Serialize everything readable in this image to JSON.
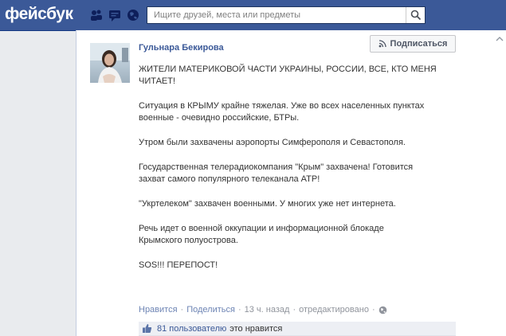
{
  "header": {
    "logo": "фейсбук",
    "search": {
      "placeholder": "Ищите друзей, места или предметы"
    }
  },
  "post": {
    "author": "Гульнара Бекирова",
    "subscribe_label": "Подписаться",
    "paragraphs": [
      "ЖИТЕЛИ МАТЕРИКОВОЙ ЧАСТИ УКРАИНЫ, РОССИИ, ВСЕ, КТО МЕНЯ\nЧИТАЕТ!",
      "Ситуация в КРЫМУ крайне тяжелая. Уже во всех населенных пунктах\nвоенные - очевидно российские, БТРы.",
      "Утром были захвачены аэропорты Симферополя и Севастополя.",
      "Государственная телерадиокомпания \"Крым\" захвачена! Готовится\nзахват самого популярного телеканала АТР!",
      "\"Укртелеком\" захвачен военными. У многих уже нет интернета.",
      "Речь идет о военной оккупации и информационной блокаде\nКрымского полуострова.",
      "SOS!!! ПЕРЕПОСТ!"
    ],
    "actions": {
      "like": "Нравится",
      "share": "Поделиться",
      "time": "13 ч. назад",
      "edited": "отредактировано",
      "dot": "·"
    },
    "likes": {
      "count_text": "81 пользователю",
      "suffix": "это нравится"
    }
  },
  "colors": {
    "brand": "#3b5998",
    "link": "#6d84b4",
    "like_bar": "#edeff4"
  },
  "icons": [
    "friends-icon",
    "messages-icon",
    "globe-icon",
    "search-icon",
    "rss-icon",
    "privacy-globe-icon",
    "thumbs-up-icon",
    "scroll-up-icon"
  ]
}
